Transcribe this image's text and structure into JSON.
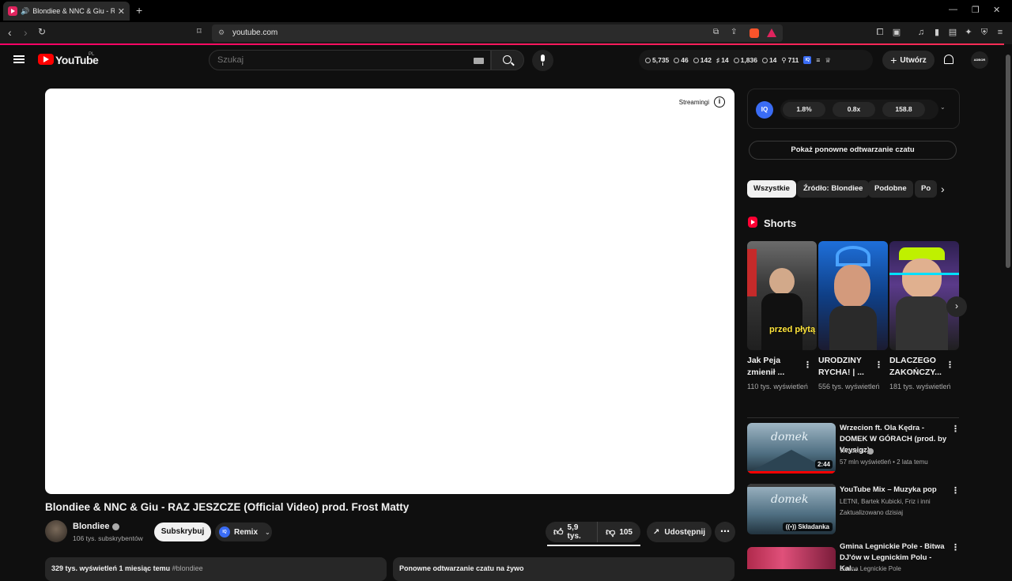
{
  "browser": {
    "tab_title": "Blondiee & NNC & Giu - RAZ",
    "new_tab": "+",
    "url": "youtube.com"
  },
  "header": {
    "logo_text": "YouTube",
    "region": "PL",
    "search_placeholder": "Szukaj",
    "stats": [
      {
        "icon": "clock-icon",
        "value": "5,735"
      },
      {
        "icon": "eye-icon",
        "value": "46"
      },
      {
        "icon": "eye-icon",
        "value": "142"
      },
      {
        "icon": "hash-icon",
        "value": "14"
      },
      {
        "icon": "eye-icon",
        "value": "1,836"
      },
      {
        "icon": "clock-icon",
        "value": "14"
      },
      {
        "icon": "person-icon",
        "value": "711"
      }
    ],
    "create_label": "Utwórz",
    "avatar_text": "ADBOR"
  },
  "player": {
    "info_label": "Streamingi"
  },
  "video": {
    "title": "Blondiee & NNC & Giu - RAZ JESZCZE (Official Video) prod. Frost Matty",
    "channel_name": "Blondiee",
    "subscribers": "106 tys. subskrybentów",
    "subscribe_label": "Subskrybuj",
    "remix_label": "Remix",
    "likes": "5,9 tys.",
    "dislikes": "105",
    "share_label": "Udostępnij",
    "description_meta": "329 tys. wyświetleń 1 miesiąc temu",
    "description_tag": "#blondiee",
    "chat_replay_note": "Ponowne odtwarzanie czatu na żywo"
  },
  "iq_panel": {
    "logo": "IQ",
    "values": [
      "1.8%",
      "0.8x",
      "158.8"
    ]
  },
  "sidebar": {
    "chat_replay_button": "Pokaż ponowne odtwarzanie czatu",
    "chips": [
      "Wszystkie",
      "Źródło: Blondiee",
      "Podobne",
      "Po"
    ],
    "shorts_heading": "Shorts",
    "shorts": [
      {
        "title": "Jak Peja zmienił ...",
        "views": "110 tys. wyświetleń",
        "overlay": "przed płytą"
      },
      {
        "title": "URODZINY RYCHA! | ...",
        "views": "556 tys. wyświetleń"
      },
      {
        "title": "DLACZEGO ZAKOŃCZY...",
        "views": "181 tys. wyświetleń"
      }
    ],
    "recommendations": [
      {
        "title": "Wrzecion ft. Ola Kędra - DOMEK W GÓRACH (prod. by Veysigz)",
        "channel": "Wrzecion",
        "meta": "57 mln wyświetleń • 2 lata temu",
        "duration": "2:44"
      },
      {
        "title": "YouTube Mix – Muzyka pop",
        "channel": "LETNI, Bartek Kubicki, Friz i inni",
        "meta": "Zaktualizowano dzisiaj",
        "badge": "Składanka"
      },
      {
        "title": "Gmina Legnickie Pole - Bitwa DJ'ów w Legnickim Polu - Kal...",
        "channel": "Gmina Legnickie Pole",
        "meta": ""
      }
    ]
  },
  "colors": {
    "background": "#0f0f0f",
    "brand_red": "#ff0000",
    "iq_blue": "#3a6cf4",
    "chip_bg": "#272727"
  }
}
